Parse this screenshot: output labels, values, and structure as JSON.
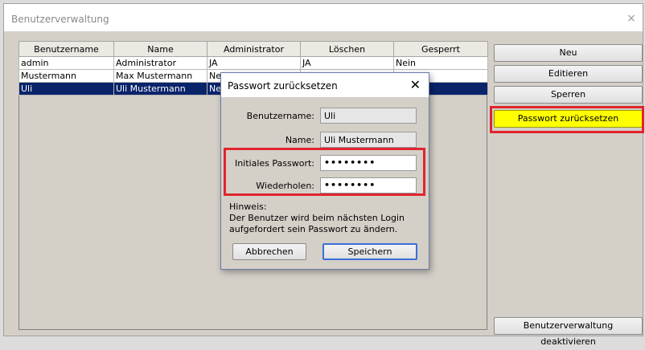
{
  "window": {
    "title": "Benutzerverwaltung",
    "close_glyph": "×"
  },
  "table": {
    "columns": [
      "Benutzername",
      "Name",
      "Administrator",
      "Löschen",
      "Gesperrt"
    ],
    "rows": [
      {
        "user": "admin",
        "name": "Administrator",
        "admin": "JA",
        "delete": "JA",
        "locked": "Nein"
      },
      {
        "user": "Mustermann",
        "name": "Max Mustermann",
        "admin": "Ne",
        "delete": "",
        "locked": ""
      },
      {
        "user": "Uli",
        "name": "Uli Mustermann",
        "admin": "Ne",
        "delete": "",
        "locked": ""
      }
    ]
  },
  "buttons": {
    "new": "Neu",
    "edit": "Editieren",
    "lock": "Sperren",
    "reset_password": "Passwort zurücksetzen",
    "deactivate": "Benutzerverwaltung deaktivieren"
  },
  "dialog": {
    "title": "Passwort zurücksetzen",
    "close_glyph": "✕",
    "username_label": "Benutzername:",
    "username_value": "Uli",
    "name_label": "Name:",
    "name_value": "Uli Mustermann",
    "initial_pw_label": "Initiales Passwort:",
    "initial_pw_value": "••••••••",
    "repeat_label": "Wiederholen:",
    "repeat_value": "••••••••",
    "hint_title": "Hinweis:",
    "hint_line1": "Der Benutzer wird beim nächsten Login",
    "hint_line2": "aufgefordert sein Passwort zu ändern.",
    "cancel": "Abbrechen",
    "save": "Speichern"
  },
  "colors": {
    "highlight": "#e0242f",
    "selection": "#0a246a",
    "accent_button": "#ffff00"
  }
}
